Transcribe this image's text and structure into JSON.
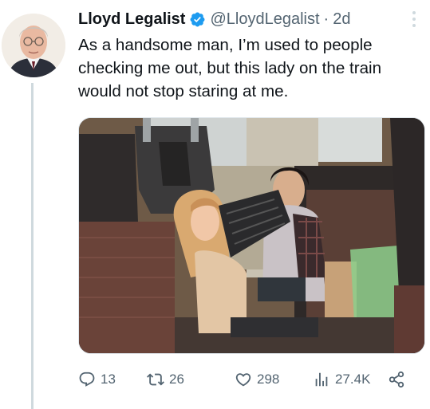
{
  "tweet": {
    "author": {
      "display_name": "Lloyd Legalist",
      "handle": "@LloydLegalist",
      "verified": true,
      "verified_color": "#1d9bf0"
    },
    "separator": "·",
    "time": "2d",
    "text": "As a handsome man, I’m used to people checking me out, but this lady on the train would not stop staring at me.",
    "media": {
      "kind": "photo"
    },
    "actions": {
      "reply": {
        "count": "13",
        "icon": "reply-icon"
      },
      "retweet": {
        "count": "26",
        "icon": "retweet-icon"
      },
      "like": {
        "count": "298",
        "icon": "heart-icon"
      },
      "views": {
        "count": "27.4K",
        "icon": "views-icon"
      },
      "share": {
        "icon": "share-icon"
      }
    }
  },
  "colors": {
    "text_primary": "#0f1419",
    "text_secondary": "#536471",
    "thread_line": "#cfd9de"
  }
}
